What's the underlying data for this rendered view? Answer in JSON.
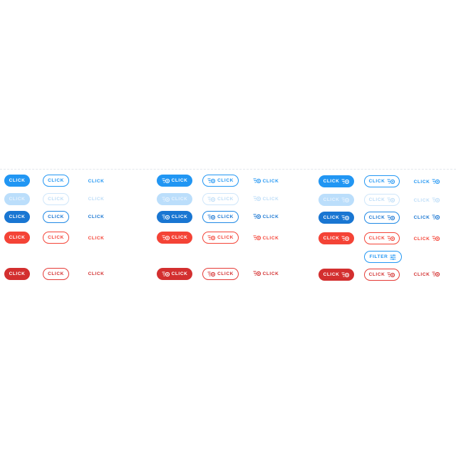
{
  "button_label": "CLICK",
  "filter_label": "FILTER",
  "icons": {
    "leading": "filter-list-icon",
    "trailing": "filter-list-icon",
    "filter": "tune-icon"
  },
  "colors": {
    "primary": "#2196f3",
    "primary_dark": "#1976d2",
    "disabled": "#bbdefb",
    "error": "#f44336",
    "error_dark": "#d32f2f",
    "divider": "#e3e7ec"
  },
  "rows": [
    {
      "name": "primary",
      "state": "default"
    },
    {
      "name": "disabled",
      "state": "disabled"
    },
    {
      "name": "hover",
      "state": "hover"
    },
    {
      "name": "error",
      "state": "error"
    },
    {
      "name": "filter",
      "state": "filter"
    },
    {
      "name": "error-hover",
      "state": "error-hover"
    }
  ]
}
